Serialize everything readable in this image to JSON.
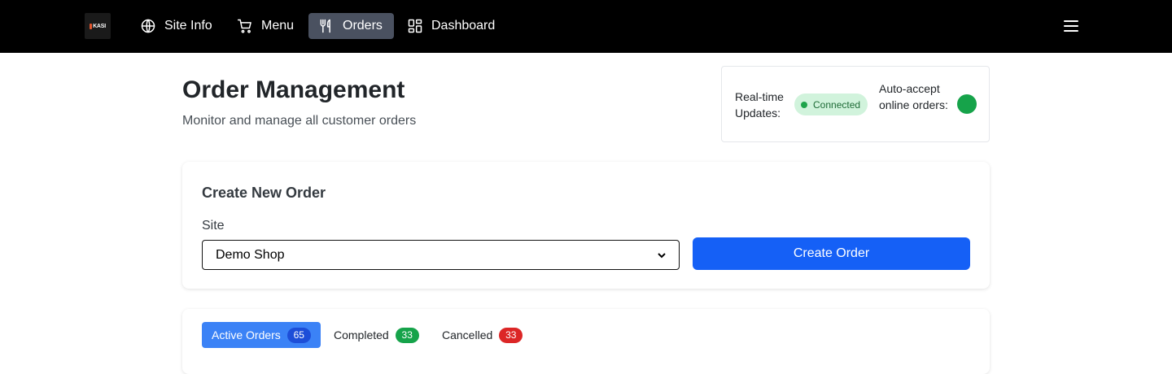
{
  "nav": {
    "logo_text": "KASI",
    "items": [
      {
        "label": "Site Info",
        "icon": "globe-icon"
      },
      {
        "label": "Menu",
        "icon": "cart-icon"
      },
      {
        "label": "Orders",
        "icon": "utensils-icon",
        "active": true
      },
      {
        "label": "Dashboard",
        "icon": "dashboard-icon"
      }
    ]
  },
  "header": {
    "title": "Order Management",
    "subtitle": "Monitor and manage all customer orders"
  },
  "status": {
    "realtime_label": "Real-time Updates:",
    "connection": "Connected",
    "auto_accept_label": "Auto-accept online orders:",
    "auto_accept_on": true
  },
  "create_order": {
    "title": "Create New Order",
    "site_label": "Site",
    "site_selected": "Demo Shop",
    "button_label": "Create Order"
  },
  "tabs": [
    {
      "label": "Active Orders",
      "count": "65",
      "active": true
    },
    {
      "label": "Completed",
      "count": "33"
    },
    {
      "label": "Cancelled",
      "count": "33"
    }
  ],
  "colors": {
    "topbar": "#000000",
    "accent": "#1560f6",
    "connected": "#16a34a",
    "cancelled": "#dc2626"
  }
}
